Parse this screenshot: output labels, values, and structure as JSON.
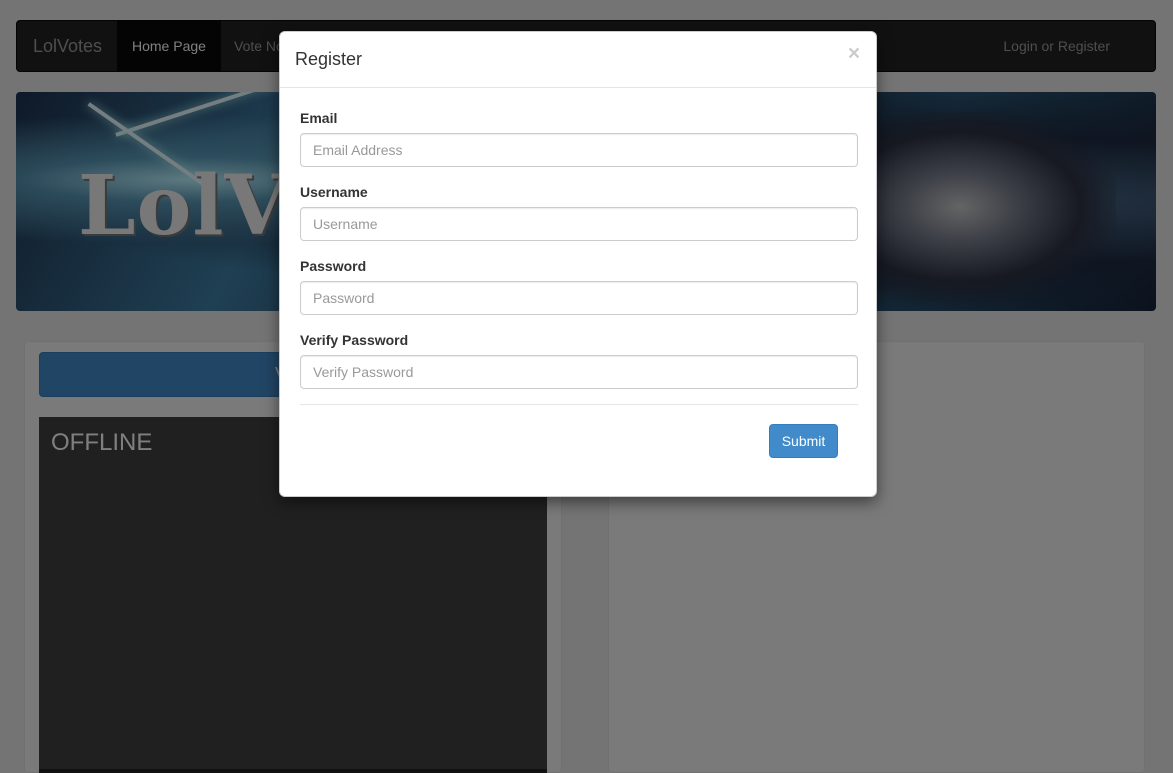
{
  "navbar": {
    "brand": "LolVotes",
    "items": [
      {
        "label": "Home Page",
        "active": true
      },
      {
        "label": "Vote Now",
        "active": false
      }
    ],
    "login_label": "Login or Register"
  },
  "banner": {
    "title": "LolVotes"
  },
  "main": {
    "vote_button_label": "Vote",
    "stream_status": "OFFLINE"
  },
  "modal": {
    "title": "Register",
    "close_symbol": "×",
    "fields": [
      {
        "label": "Email",
        "placeholder": "Email Address",
        "value": ""
      },
      {
        "label": "Username",
        "placeholder": "Username",
        "value": ""
      },
      {
        "label": "Password",
        "placeholder": "Password",
        "value": ""
      },
      {
        "label": "Verify Password",
        "placeholder": "Verify Password",
        "value": ""
      }
    ],
    "submit_label": "Submit"
  },
  "colors": {
    "primary": "#428bca",
    "navbar": "#222222",
    "backdrop": "rgba(0,0,0,0.5)"
  }
}
